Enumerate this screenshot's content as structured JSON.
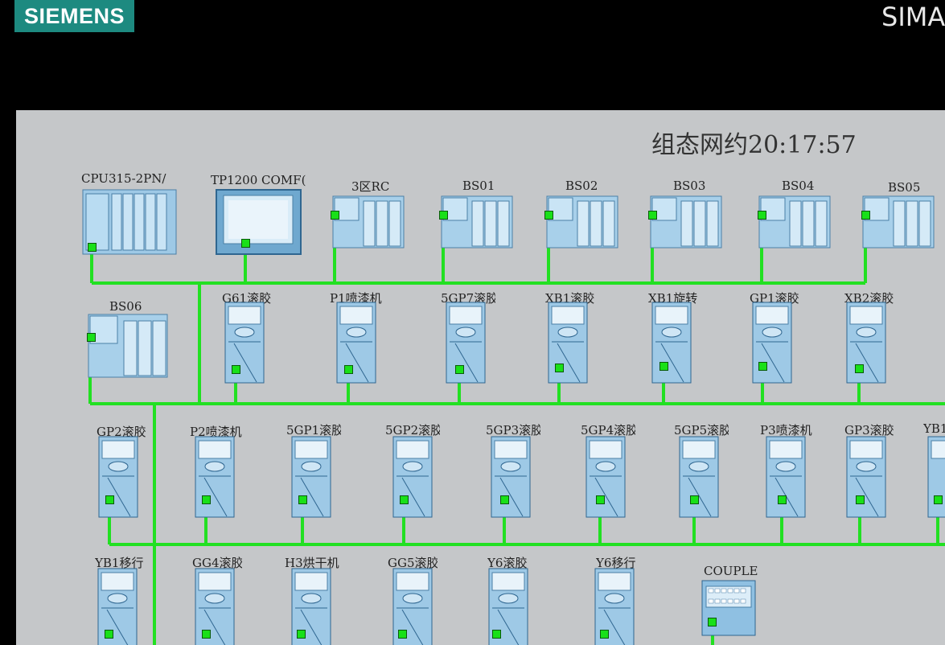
{
  "header": {
    "logo": "SIEMENS",
    "brand_right": "SIMA"
  },
  "screen": {
    "title_time": "组态网约20:17:57"
  },
  "devices": [
    {
      "label": "CPU315-2PN/",
      "type": "cpu"
    },
    {
      "label": "TP1200 COMF(",
      "type": "hmi"
    },
    {
      "label": "3区RC",
      "type": "io"
    },
    {
      "label": "BS01",
      "type": "io"
    },
    {
      "label": "BS02",
      "type": "io"
    },
    {
      "label": "BS03",
      "type": "io"
    },
    {
      "label": "BS04",
      "type": "io"
    },
    {
      "label": "BS05",
      "type": "io"
    },
    {
      "label": "BS06",
      "type": "io"
    },
    {
      "label": "G61滚胶",
      "type": "drive"
    },
    {
      "label": "P1喷漆机",
      "type": "drive"
    },
    {
      "label": "5GP7滚胶",
      "type": "drive"
    },
    {
      "label": "XB1滚胶",
      "type": "drive"
    },
    {
      "label": "XB1旋转",
      "type": "drive"
    },
    {
      "label": "GP1滚胶",
      "type": "drive"
    },
    {
      "label": "XB2滚胶",
      "type": "drive"
    },
    {
      "label": "GP2滚胶",
      "type": "drive"
    },
    {
      "label": "P2喷漆机",
      "type": "drive"
    },
    {
      "label": "5GP1滚胶",
      "type": "drive"
    },
    {
      "label": "5GP2滚胶",
      "type": "drive"
    },
    {
      "label": "5GP3滚胶",
      "type": "drive"
    },
    {
      "label": "5GP4滚胶",
      "type": "drive"
    },
    {
      "label": "5GP5滚胶",
      "type": "drive"
    },
    {
      "label": "P3喷漆机",
      "type": "drive"
    },
    {
      "label": "GP3滚胶",
      "type": "drive"
    },
    {
      "label": "YB1",
      "type": "drive"
    },
    {
      "label": "YB1移行",
      "type": "drive"
    },
    {
      "label": "GG4滚胶",
      "type": "drive"
    },
    {
      "label": "H3烘干机",
      "type": "drive"
    },
    {
      "label": "GG5滚胶",
      "type": "drive"
    },
    {
      "label": "Y6滚胶",
      "type": "drive"
    },
    {
      "label": "Y6移行",
      "type": "drive"
    },
    {
      "label": "COUPLE",
      "type": "coupler"
    }
  ],
  "colors": {
    "network_line": "#22e022",
    "port": "#19e019",
    "device_body": "#9ec9e6",
    "screen_bg": "#c5c7c9"
  }
}
